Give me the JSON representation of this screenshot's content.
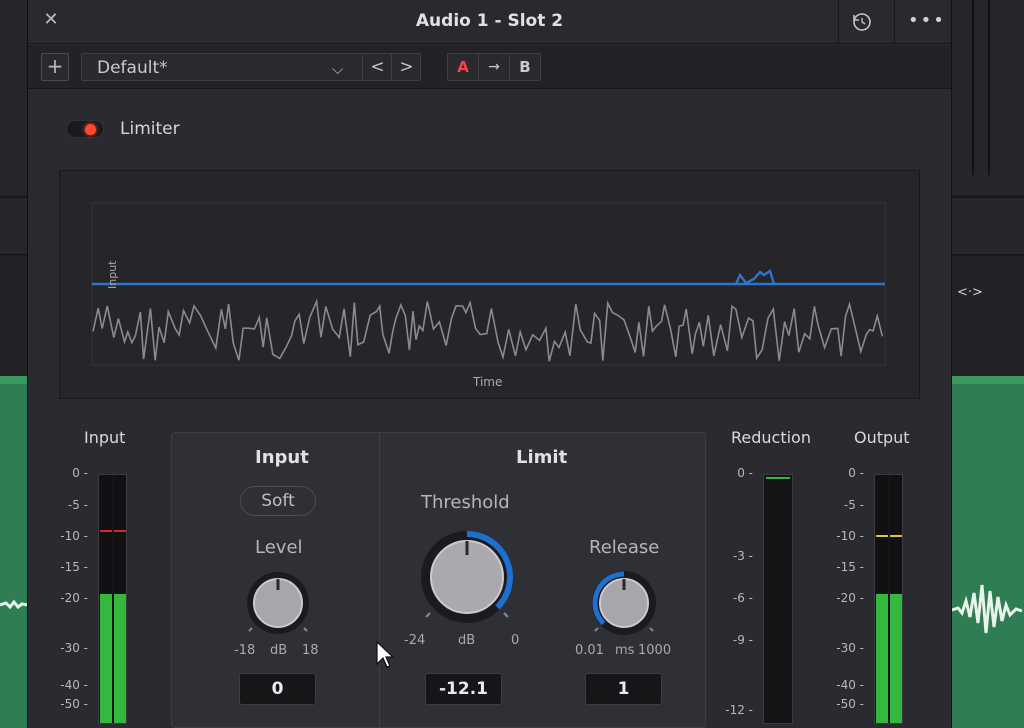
{
  "window": {
    "title": "Audio 1 - Slot 2",
    "close_icon": "close-icon",
    "reset_icon": "reset-icon",
    "more_icon": "more-icon"
  },
  "toolbar": {
    "add_label": "+",
    "preset_value": "Default*",
    "prev_label": "<",
    "next_label": ">",
    "a_label": "A",
    "copy_label": "→",
    "b_label": "B"
  },
  "limiter": {
    "label": "Limiter",
    "enabled": true
  },
  "graph": {
    "y_label": "Input",
    "x_label": "Time",
    "threshold_color": "#2f74c9",
    "signal_color": "#8a8a92"
  },
  "meters": {
    "input": {
      "title": "Input",
      "ticks": [
        "0",
        "-5",
        "-10",
        "-15",
        "-20",
        "-30",
        "-40",
        "-50"
      ],
      "level_db": -20,
      "peak_db": -10
    },
    "reduction": {
      "title": "Reduction",
      "ticks": [
        "0",
        "-3",
        "-6",
        "-9",
        "-12"
      ],
      "level_db": 0
    },
    "output": {
      "title": "Output",
      "ticks": [
        "0",
        "-5",
        "-10",
        "-15",
        "-20",
        "-30",
        "-40",
        "-50"
      ],
      "level_db": -20,
      "peak_db": -10
    }
  },
  "input_section": {
    "title": "Input",
    "soft_label": "Soft",
    "level": {
      "label": "Level",
      "min": "-18",
      "unit": "dB",
      "max": "18",
      "value": "0"
    }
  },
  "limit_section": {
    "title": "Limit",
    "threshold": {
      "label": "Threshold",
      "min": "-24",
      "unit": "dB",
      "max": "0",
      "value": "-12.1"
    },
    "release": {
      "label": "Release",
      "min": "0.01",
      "unit": "ms",
      "max": "1000",
      "value": "1"
    }
  },
  "colors": {
    "accent_blue": "#1f6fd0",
    "meter_green": "#34b83e",
    "peak_red": "#d8262b",
    "peak_yellow": "#e6c23a",
    "toggle_on": "#ff4a2e"
  }
}
